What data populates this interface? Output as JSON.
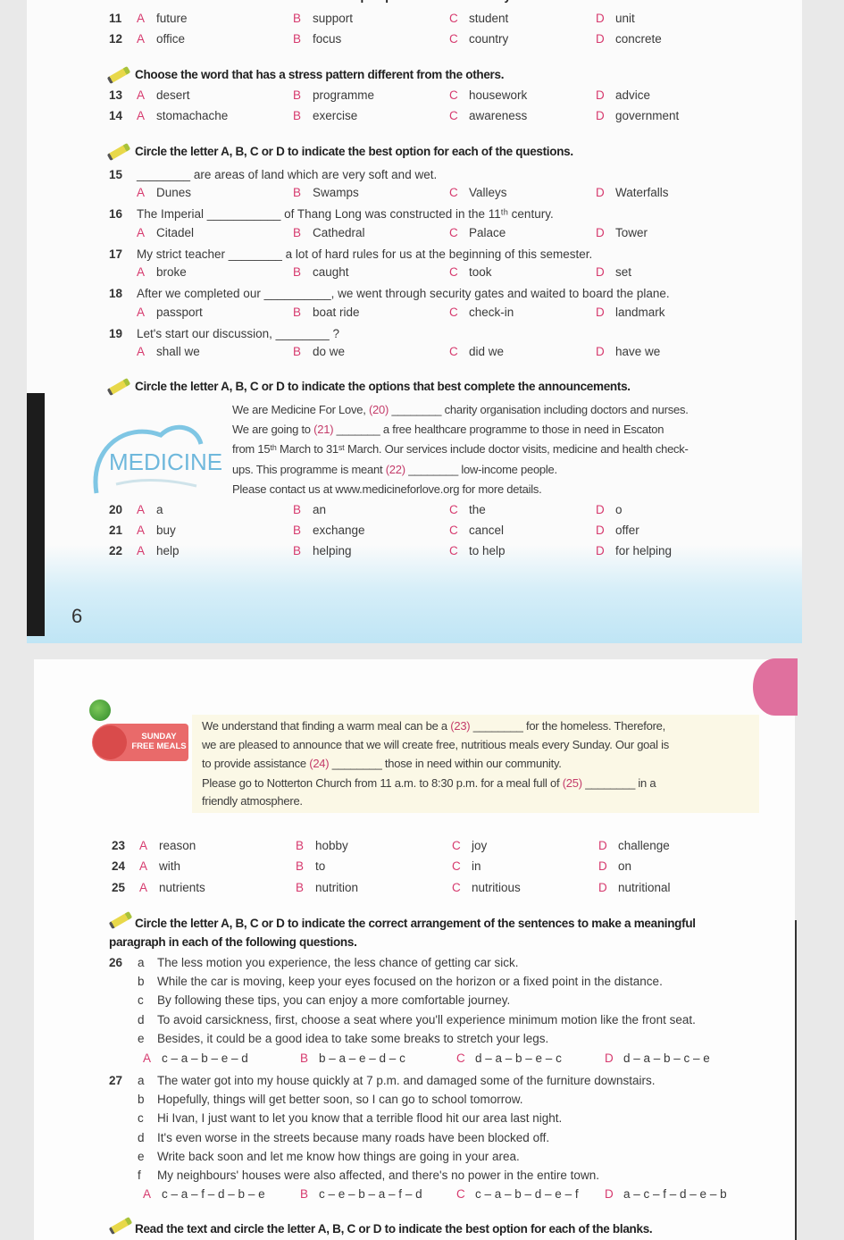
{
  "page1": {
    "cut_instruction": "Choose the word that has the underlined part pronounced differently from the others.",
    "page_number": "6",
    "instructions": [
      "Choose the word that has a stress pattern different from the others.",
      "Circle the letter A, B, C or D to indicate the best option for each of the questions.",
      "Circle the letter A, B, C or D to indicate the options that best complete the announcements."
    ],
    "announcement": {
      "logo_text": "MEDICINE",
      "lines": [
        "We are Medicine For Love, (20) ________ charity organisation including doctors and nurses.",
        "We are going to (21) _______ a free healthcare programme to those in need in Escaton",
        "from 15ᵗʰ March to 31ˢᵗ March. Our services include doctor visits, medicine and health check-",
        "ups. This programme is meant (22) ________ low-income people.",
        "Please contact us at www.medicineforlove.org for more details."
      ]
    }
  },
  "letters": [
    "A",
    "B",
    "C",
    "D"
  ],
  "mcq": [
    {
      "num": "11",
      "options": [
        "future",
        "support",
        "student",
        "unit"
      ]
    },
    {
      "num": "12",
      "options": [
        "office",
        "focus",
        "country",
        "concrete"
      ]
    },
    {
      "num": "13",
      "options": [
        "desert",
        "programme",
        "housework",
        "advice"
      ]
    },
    {
      "num": "14",
      "options": [
        "stomachache",
        "exercise",
        "awareness",
        "government"
      ]
    },
    {
      "num": "15",
      "stem": "________ are areas of land which are very soft and wet.",
      "options": [
        "Dunes",
        "Swamps",
        "Valleys",
        "Waterfalls"
      ]
    },
    {
      "num": "16",
      "stem": "The Imperial ___________ of Thang Long was constructed in the 11ᵗʰ century.",
      "options": [
        "Citadel",
        "Cathedral",
        "Palace",
        "Tower"
      ]
    },
    {
      "num": "17",
      "stem": "My strict teacher ________ a lot of hard rules for us at the beginning of this semester.",
      "options": [
        "broke",
        "caught",
        "took",
        "set"
      ]
    },
    {
      "num": "18",
      "stem": "After we completed our __________, we went through security gates and waited to board the plane.",
      "options": [
        "passport",
        "boat ride",
        "check-in",
        "landmark"
      ]
    },
    {
      "num": "19",
      "stem": "Let's start our discussion, ________ ?",
      "options": [
        "shall we",
        "do we",
        "did we",
        "have we"
      ]
    },
    {
      "num": "20",
      "options": [
        "a",
        "an",
        "the",
        "o"
      ]
    },
    {
      "num": "21",
      "options": [
        "buy",
        "exchange",
        "cancel",
        "offer"
      ]
    },
    {
      "num": "22",
      "options": [
        "help",
        "helping",
        "to help",
        "for helping"
      ]
    },
    {
      "num": "23",
      "options": [
        "reason",
        "hobby",
        "joy",
        "challenge"
      ]
    },
    {
      "num": "24",
      "options": [
        "with",
        "to",
        "in",
        "on"
      ]
    },
    {
      "num": "25",
      "options": [
        "nutrients",
        "nutrition",
        "nutritious",
        "nutritional"
      ]
    }
  ],
  "page2": {
    "announcement": {
      "badge_line1": "SUNDAY",
      "badge_line2": "FREE MEALS",
      "lines": [
        "We understand that finding a warm meal can be a (23) ________ for the homeless. Therefore,",
        "we are pleased to announce that we will create free, nutritious meals every Sunday. Our goal is",
        "to provide assistance (24) ________ those in need within our community.",
        "Please go to Notterton Church from 11 a.m. to 8:30 p.m. for a meal full of (25) ________ in a",
        "friendly atmosphere."
      ]
    },
    "instruction_arrange_line1": "Circle the letter A, B, C or D to indicate the correct arrangement of the sentences to make a meaningful",
    "instruction_arrange_line2": "paragraph in each of the following questions.",
    "instruction_read": "Read the text and circle the letter A, B, C or D to indicate the best option for each of the blanks.",
    "arrangement": [
      {
        "num": "26",
        "sentences": [
          {
            "letter": "a",
            "text": "The less motion you experience, the less chance of getting car sick."
          },
          {
            "letter": "b",
            "text": "While the car is moving, keep your eyes focused on the horizon or a fixed point in the distance."
          },
          {
            "letter": "c",
            "text": "By following these tips, you can enjoy a more comfortable journey."
          },
          {
            "letter": "d",
            "text": "To avoid carsickness, first, choose a seat where you'll experience minimum motion like the front seat."
          },
          {
            "letter": "e",
            "text": "Besides, it could be a good idea to take some breaks to stretch your legs."
          }
        ],
        "options": [
          "c – a – b – e – d",
          "b – a – e – d – c",
          "d – a – b – e – c",
          "d – a – b – c – e"
        ]
      },
      {
        "num": "27",
        "sentences": [
          {
            "letter": "a",
            "text": "The water got into my house quickly at 7 p.m. and damaged some of the furniture downstairs."
          },
          {
            "letter": "b",
            "text": "Hopefully, things will get better soon, so I can go to school tomorrow."
          },
          {
            "letter": "c",
            "text": "Hi Ivan, I just want to let you know that a terrible flood hit our area last night."
          },
          {
            "letter": "d",
            "text": "It's even worse in the streets because many roads have been blocked off."
          },
          {
            "letter": "e",
            "text": "Write back soon and let me know how things are going in your area."
          },
          {
            "letter": "f",
            "text": "My neighbours' houses were also affected, and there's no power in the entire town."
          }
        ],
        "options": [
          "c – a – f – d – b – e",
          "c – e – b – a – f – d",
          "c – a – b – d – e – f",
          "a – c – f – d – e – b"
        ]
      }
    ]
  }
}
